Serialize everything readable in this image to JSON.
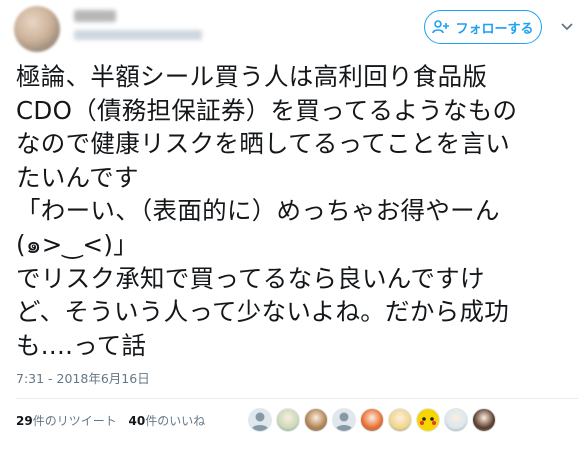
{
  "tweet": {
    "follow_label": "フォローする",
    "lines": [
      "極論、半額シール買う人は高利回り食品版",
      "CDO（債務担保証券）を買ってるようなもの",
      "なので健康リスクを晒してるってことを言い",
      "たいんです",
      "「わーい、（表面的に）めっちゃお得やーん",
      "(๑>‿<)」",
      "でリスク承知で買ってるなら良いんですけ",
      "ど、そういう人って少ないよね。だから成功",
      "も....って話"
    ],
    "timestamp": "7:31 - 2018年6月16日"
  },
  "stats": {
    "retweets_count": "29",
    "retweets_label": "件のリツイート",
    "likes_count": "40",
    "likes_label": "件のいいね"
  },
  "likers": [
    {
      "icon": "default-avatar-icon",
      "color": "#8899a6"
    },
    {
      "icon": "anime-avatar-icon",
      "color": "#c9d8b6"
    },
    {
      "icon": "anime-avatar-icon",
      "color": "#b08050"
    },
    {
      "icon": "default-avatar-icon",
      "color": "#8899a6"
    },
    {
      "icon": "anime-avatar-icon",
      "color": "#e86a2a"
    },
    {
      "icon": "anime-avatar-icon",
      "color": "#f2d58a"
    },
    {
      "icon": "pikachu-avatar-icon",
      "color": "#f6d500"
    },
    {
      "icon": "anime-avatar-icon",
      "color": "#d9e7ef"
    },
    {
      "icon": "photo-avatar-icon",
      "color": "#5a3b2a"
    }
  ],
  "colors": {
    "accent": "#1da1f2",
    "text": "#14171a",
    "muted": "#657786"
  }
}
